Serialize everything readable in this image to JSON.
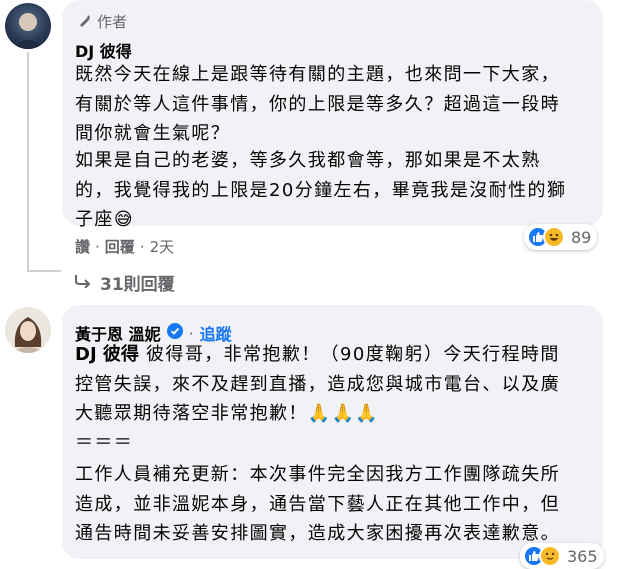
{
  "comment1": {
    "author_tag": "作者",
    "name": "DJ 彼得",
    "paragraph1": [
      "既然今天在線上是跟等待有關的主題，也來問一下大家，",
      "有關於等人這件事情，你的上限是等多久？超過這一段時",
      "間你就會生氣呢？"
    ],
    "paragraph2": [
      "如果是自己的老婆，等多久我都會等，那如果是不太熟",
      "的，我覺得我的上限是20分鐘左右，畢竟我是沒耐性的獅",
      "子座"
    ],
    "emoji": "😅",
    "like_label": "讚",
    "reply_label": "回覆",
    "time": "2天",
    "reaction_count": "89"
  },
  "replies_link": "31則回覆",
  "comment2": {
    "name": "黃于恩 溫妮",
    "follow_label": "追蹤",
    "mention": "DJ 彼得",
    "paragraph1": [
      " 彼得哥，非常抱歉！（90度鞠躬）今天行程時間",
      "控管失誤，來不及趕到直播，造成您與城市電台、以及廣",
      "大聽眾期待落空非常抱歉！"
    ],
    "emoji": "🙏🙏🙏",
    "separator": "＝＝＝",
    "paragraph2": [
      "工作人員補充更新：本次事件完全因我方工作團隊疏失所",
      "造成，並非溫妮本身，通告當下藝人正在其他工作中，但",
      "通告時間未妥善安排圖實，造成大家困擾再次表達歉意。"
    ],
    "reaction_count": "365"
  },
  "colors": {
    "accent": "#1877f2",
    "bubble": "#f0f2f5",
    "meta": "#65676b"
  }
}
